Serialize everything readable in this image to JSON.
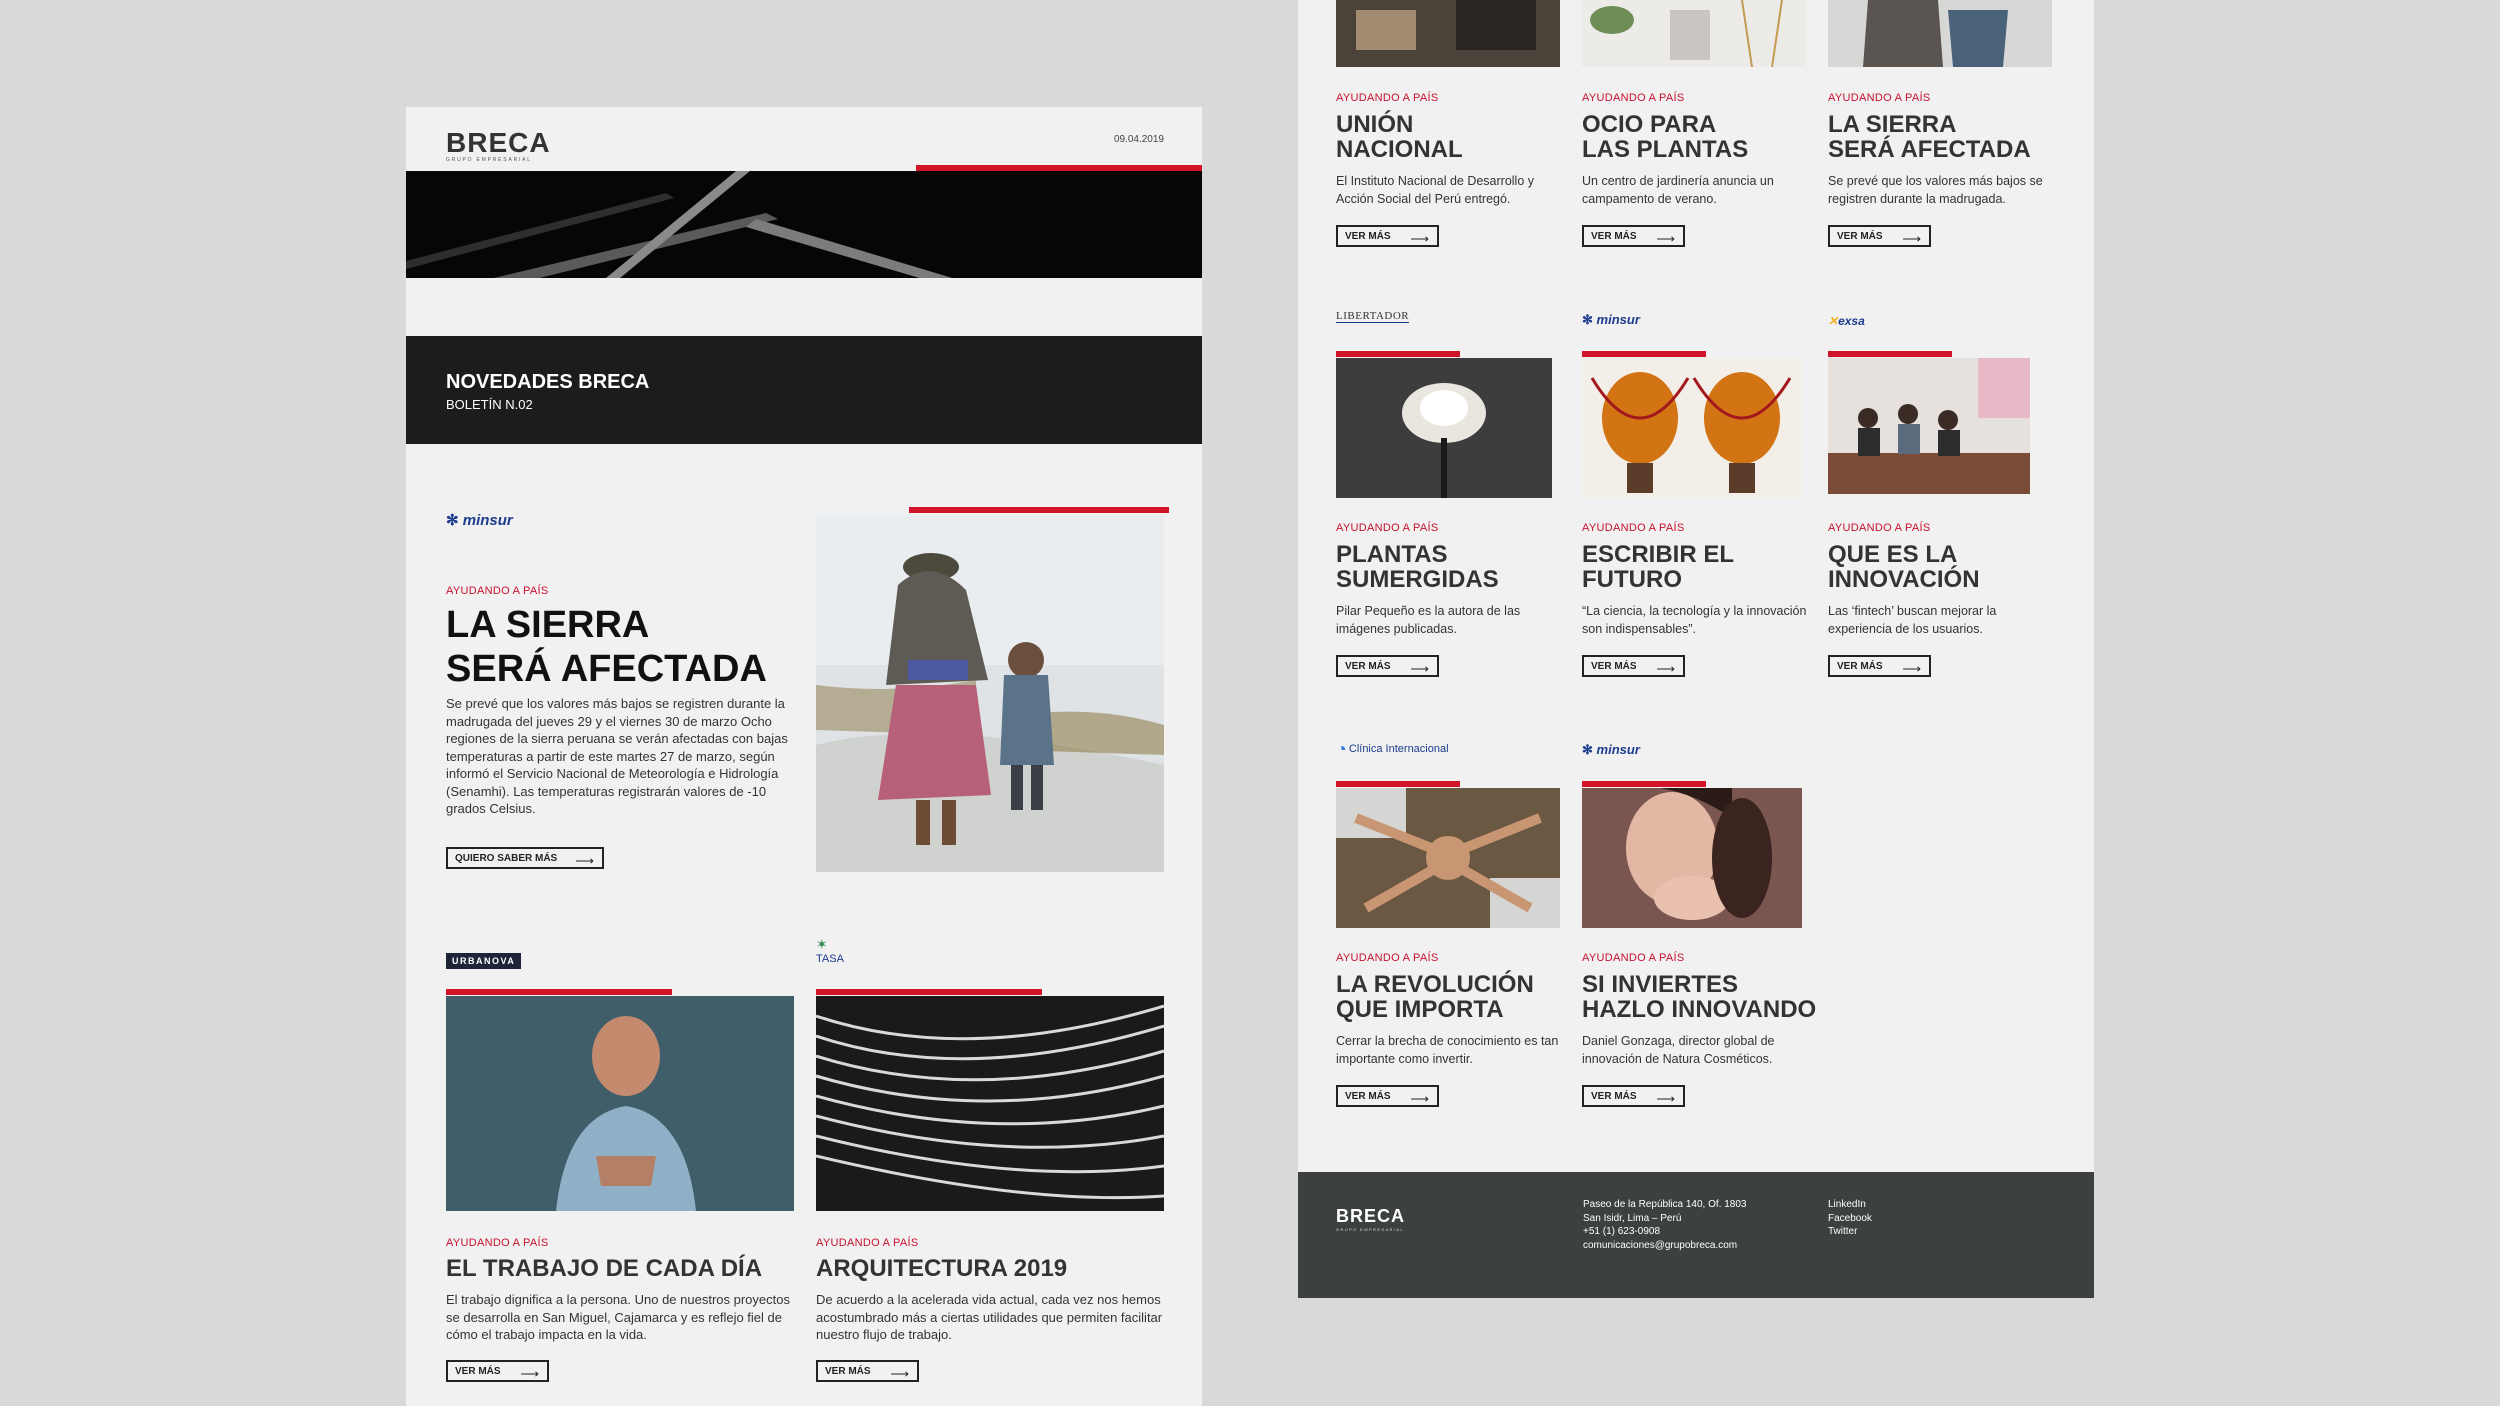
{
  "colors": {
    "accent": "#d2142b",
    "dark": "#1c1c1c",
    "footer": "#3c403e"
  },
  "header": {
    "logo": "BRECA",
    "logo_sub": "GRUPO EMPRESARIAL",
    "date": "09.04.2019"
  },
  "hero": {
    "title": "NOVEDADES BRECA",
    "subtitle": "BOLETÍN N.02"
  },
  "featured": {
    "brand": "minsur",
    "kicker": "AYUDANDO A PAÍS",
    "title_line1": "LA SIERRA",
    "title_line2": "SERÁ AFECTADA",
    "body": "Se prevé que los valores más bajos se registren durante la madrugada del jueves 29 y el viernes 30 de marzo Ocho regiones de la sierra peruana se verán afectadas con bajas temperaturas a partir de este martes 27 de marzo, según informó el Servicio Nacional de Meteorología e Hidrología (Senamhi). Las temperaturas registrarán valores de -10 grados Celsius.",
    "button": "QUIERO SABER MÁS"
  },
  "left_cards": [
    {
      "brand": "URBANOVA",
      "kicker": "AYUDANDO A PAÍS",
      "title": "EL TRABAJO DE CADA DÍA",
      "text": "El trabajo dignifica a la persona. Uno de nuestros proyectos se desarrolla en San Miguel, Cajamarca y es reflejo fiel de cómo el trabajo impacta en la vida.",
      "button": "VER MÁS"
    },
    {
      "brand": "TASA",
      "kicker": "AYUDANDO A PAÍS",
      "title": "ARQUITECTURA 2019",
      "text": "De acuerdo a la acelerada vida actual, cada vez nos hemos acostumbrado más a ciertas utilidades que permiten facilitar nuestro flujo de trabajo.",
      "button": "VER MÁS"
    }
  ],
  "grid": [
    {
      "kicker": "AYUDANDO A PAÍS",
      "title1": "UNIÓN",
      "title2": "NACIONAL",
      "text": "El Instituto Nacional de Desarrollo y Acción Social del Perú entregó.",
      "button": "VER MÁS"
    },
    {
      "kicker": "AYUDANDO A PAÍS",
      "title1": "OCIO PARA",
      "title2": "LAS PLANTAS",
      "text": "Un centro de jardinería anuncia un campamento de verano.",
      "button": "VER MÁS"
    },
    {
      "kicker": "AYUDANDO A PAÍS",
      "title1": "LA SIERRA",
      "title2": "SERÁ AFECTADA",
      "text": "Se prevé que los valores más bajos se registren durante la madrugada.",
      "button": "VER MÁS"
    },
    {
      "brand": "LIBERTADOR",
      "kicker": "AYUDANDO A PAÍS",
      "title1": "PLANTAS",
      "title2": "SUMERGIDAS",
      "text": "Pilar Pequeño es la autora de las imágenes publicadas.",
      "button": "VER MÁS"
    },
    {
      "brand": "minsur",
      "kicker": "AYUDANDO A PAÍS",
      "title1": "ESCRIBIR EL",
      "title2": "FUTURO",
      "text": "“La ciencia, la tecnología y la innovación son indispensables”.",
      "button": "VER MÁS"
    },
    {
      "brand": "exsa",
      "kicker": "AYUDANDO A PAÍS",
      "title1": "QUE ES LA",
      "title2": "INNOVACIÓN",
      "text": "Las ‘fintech’ buscan mejorar la experiencia de los usuarios.",
      "button": "VER MÁS"
    },
    {
      "brand": "Clínica Internacional",
      "kicker": "AYUDANDO A PAÍS",
      "title1": "LA REVOLUCIÓN",
      "title2": "QUE IMPORTA",
      "text": "Cerrar la brecha de conocimiento es tan importante como invertir.",
      "button": "VER MÁS"
    },
    {
      "brand": "minsur",
      "kicker": "AYUDANDO A PAÍS",
      "title1": "SI INVIERTES",
      "title2": "HAZLO INNOVANDO",
      "text": "Daniel Gonzaga, director global de innovación de Natura Cosméticos.",
      "button": "VER MÁS"
    }
  ],
  "footer": {
    "logo": "BRECA",
    "logo_sub": "GRUPO EMPRESARIAL",
    "address1": "Paseo de la República 140, Of. 1803",
    "address2": "San Isidr, Lima – Perú",
    "phone": "+51 (1) 623-0908",
    "email": "comunicaciones@grupobreca.com",
    "links": [
      "LinkedIn",
      "Facebook",
      "Twitter"
    ]
  },
  "icons": {
    "arrow": "arrow-right-icon",
    "brand_mark": "minsur-star-icon"
  }
}
